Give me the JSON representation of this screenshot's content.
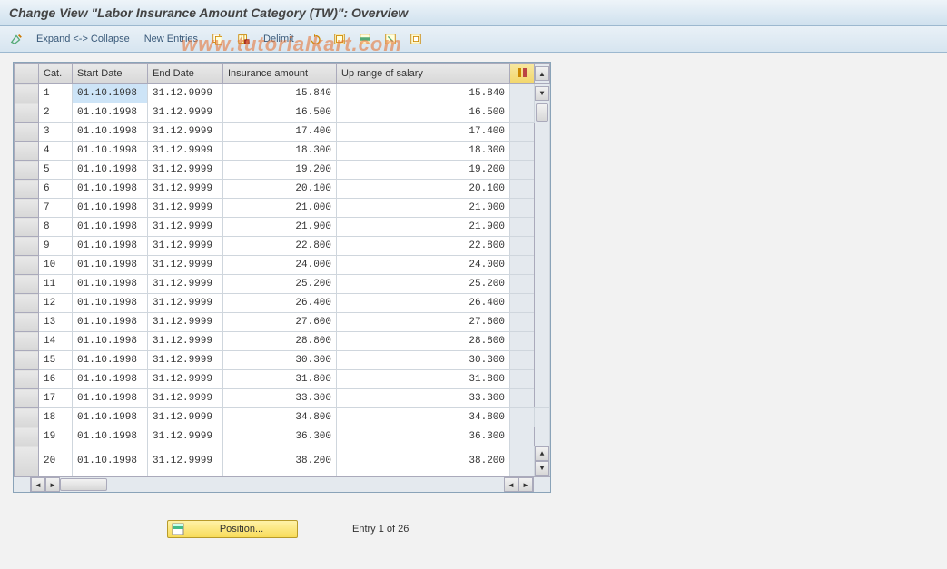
{
  "title": "Change View \"Labor Insurance Amount Category (TW)\": Overview",
  "watermark": "www.tutorialkart.com",
  "toolbar": {
    "expand": "Expand <-> Collapse",
    "new_entries": "New Entries",
    "delimit": "Delimit"
  },
  "columns": {
    "cat": "Cat.",
    "start": "Start Date",
    "end": "End Date",
    "amount": "Insurance amount",
    "range": "Up range of salary"
  },
  "rows": [
    {
      "cat": "1",
      "start": "01.10.1998",
      "end": "31.12.9999",
      "amount": "15.840",
      "range": "15.840"
    },
    {
      "cat": "2",
      "start": "01.10.1998",
      "end": "31.12.9999",
      "amount": "16.500",
      "range": "16.500"
    },
    {
      "cat": "3",
      "start": "01.10.1998",
      "end": "31.12.9999",
      "amount": "17.400",
      "range": "17.400"
    },
    {
      "cat": "4",
      "start": "01.10.1998",
      "end": "31.12.9999",
      "amount": "18.300",
      "range": "18.300"
    },
    {
      "cat": "5",
      "start": "01.10.1998",
      "end": "31.12.9999",
      "amount": "19.200",
      "range": "19.200"
    },
    {
      "cat": "6",
      "start": "01.10.1998",
      "end": "31.12.9999",
      "amount": "20.100",
      "range": "20.100"
    },
    {
      "cat": "7",
      "start": "01.10.1998",
      "end": "31.12.9999",
      "amount": "21.000",
      "range": "21.000"
    },
    {
      "cat": "8",
      "start": "01.10.1998",
      "end": "31.12.9999",
      "amount": "21.900",
      "range": "21.900"
    },
    {
      "cat": "9",
      "start": "01.10.1998",
      "end": "31.12.9999",
      "amount": "22.800",
      "range": "22.800"
    },
    {
      "cat": "10",
      "start": "01.10.1998",
      "end": "31.12.9999",
      "amount": "24.000",
      "range": "24.000"
    },
    {
      "cat": "11",
      "start": "01.10.1998",
      "end": "31.12.9999",
      "amount": "25.200",
      "range": "25.200"
    },
    {
      "cat": "12",
      "start": "01.10.1998",
      "end": "31.12.9999",
      "amount": "26.400",
      "range": "26.400"
    },
    {
      "cat": "13",
      "start": "01.10.1998",
      "end": "31.12.9999",
      "amount": "27.600",
      "range": "27.600"
    },
    {
      "cat": "14",
      "start": "01.10.1998",
      "end": "31.12.9999",
      "amount": "28.800",
      "range": "28.800"
    },
    {
      "cat": "15",
      "start": "01.10.1998",
      "end": "31.12.9999",
      "amount": "30.300",
      "range": "30.300"
    },
    {
      "cat": "16",
      "start": "01.10.1998",
      "end": "31.12.9999",
      "amount": "31.800",
      "range": "31.800"
    },
    {
      "cat": "17",
      "start": "01.10.1998",
      "end": "31.12.9999",
      "amount": "33.300",
      "range": "33.300"
    },
    {
      "cat": "18",
      "start": "01.10.1998",
      "end": "31.12.9999",
      "amount": "34.800",
      "range": "34.800"
    },
    {
      "cat": "19",
      "start": "01.10.1998",
      "end": "31.12.9999",
      "amount": "36.300",
      "range": "36.300"
    },
    {
      "cat": "20",
      "start": "01.10.1998",
      "end": "31.12.9999",
      "amount": "38.200",
      "range": "38.200"
    }
  ],
  "footer": {
    "position": "Position...",
    "entry": "Entry 1 of 26"
  }
}
